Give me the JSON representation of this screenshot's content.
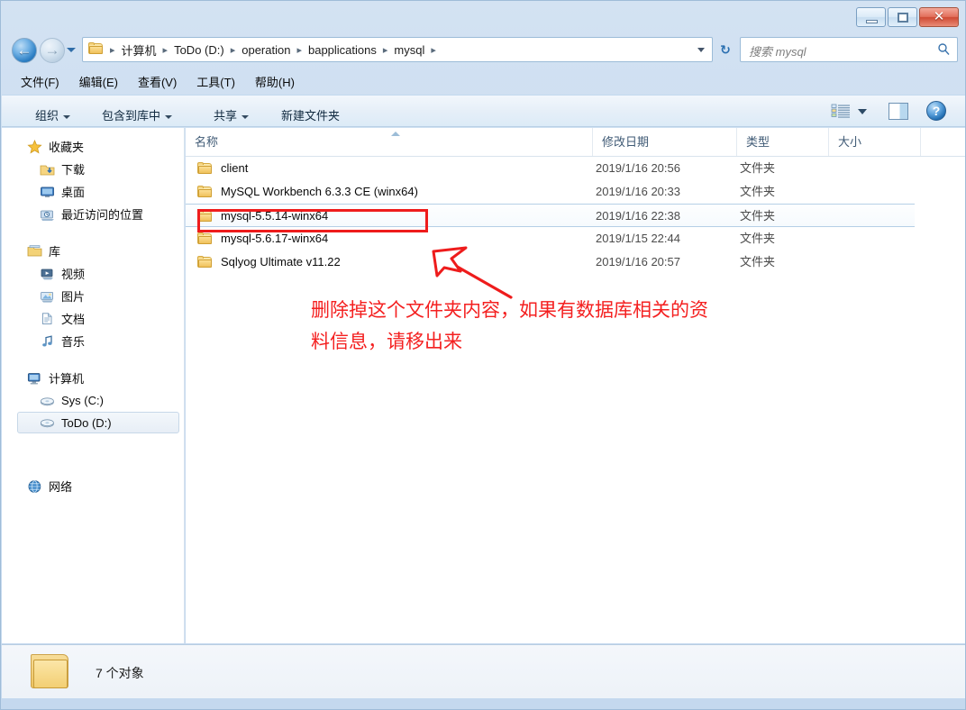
{
  "window": {
    "controls": {
      "minimize": "minimize-button",
      "maximize": "maximize-button",
      "close_glyph": "✕"
    }
  },
  "addressbar": {
    "back_glyph": "←",
    "forward_glyph": "→",
    "crumbs": [
      "计算机",
      "ToDo (D:)",
      "operation",
      "bapplications",
      "mysql"
    ],
    "separator": "▸",
    "refresh_glyph": "↻"
  },
  "search": {
    "placeholder": "搜索 mysql",
    "value": "",
    "icon": "🔍"
  },
  "menubar": {
    "items": [
      "文件(F)",
      "编辑(E)",
      "查看(V)",
      "工具(T)",
      "帮助(H)"
    ]
  },
  "toolbar": {
    "organize": "组织",
    "include_in_library": "包含到库中",
    "share": "共享",
    "new_folder": "新建文件夹",
    "help_glyph": "?"
  },
  "sidebar": {
    "groups": [
      {
        "title": "收藏夹",
        "icon": "star-icon",
        "items": [
          {
            "label": "下载",
            "icon": "download-folder-icon"
          },
          {
            "label": "桌面",
            "icon": "desktop-icon"
          },
          {
            "label": "最近访问的位置",
            "icon": "recent-places-icon"
          }
        ]
      },
      {
        "title": "库",
        "icon": "library-icon",
        "items": [
          {
            "label": "视频",
            "icon": "video-library-icon"
          },
          {
            "label": "图片",
            "icon": "pictures-library-icon"
          },
          {
            "label": "文档",
            "icon": "documents-library-icon"
          },
          {
            "label": "音乐",
            "icon": "music-library-icon"
          }
        ]
      },
      {
        "title": "计算机",
        "icon": "computer-icon",
        "items": [
          {
            "label": "Sys (C:)",
            "icon": "local-disk-icon",
            "selected": false
          },
          {
            "label": "ToDo (D:)",
            "icon": "local-disk-icon",
            "selected": true
          }
        ]
      },
      {
        "title": "网络",
        "icon": "network-icon",
        "items": []
      }
    ]
  },
  "filelist": {
    "columns": [
      "名称",
      "修改日期",
      "类型",
      "大小"
    ],
    "sorted_by": "名称",
    "rows": [
      {
        "name": "client",
        "date": "2019/1/16 20:56",
        "type": "文件夹",
        "size": "",
        "selected": false
      },
      {
        "name": "MySQL Workbench 6.3.3 CE (winx64)",
        "date": "2019/1/16 20:33",
        "type": "文件夹",
        "size": "",
        "selected": false
      },
      {
        "name": "mysql-5.5.14-winx64",
        "date": "2019/1/16 22:38",
        "type": "文件夹",
        "size": "",
        "selected": true
      },
      {
        "name": "mysql-5.6.17-winx64",
        "date": "2019/1/15 22:44",
        "type": "文件夹",
        "size": "",
        "selected": false
      },
      {
        "name": "Sqlyog Ultimate v11.22",
        "date": "2019/1/16 20:57",
        "type": "文件夹",
        "size": "",
        "selected": false
      }
    ]
  },
  "annotation": {
    "text": "删除掉这个文件夹内容，如果有数据库相关的资\n料信息，请移出来",
    "color": "#f42020",
    "highlight_target": "mysql-5.5.14-winx64"
  },
  "statusbar": {
    "text": "7 个对象"
  }
}
